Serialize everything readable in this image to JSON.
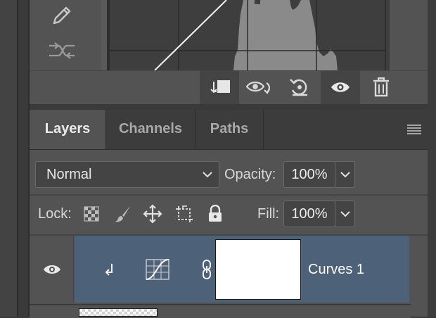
{
  "properties": {
    "tools": [
      {
        "icon": "pencil-icon"
      },
      {
        "icon": "smooth-curve-icon"
      }
    ],
    "footer_buttons": [
      {
        "icon": "clip-to-layer-icon"
      },
      {
        "icon": "view-previous-state-icon"
      },
      {
        "icon": "reset-icon"
      },
      {
        "icon": "visibility-icon"
      },
      {
        "icon": "trash-icon"
      }
    ]
  },
  "layers_panel": {
    "tabs": [
      {
        "label": "Layers",
        "active": true
      },
      {
        "label": "Channels",
        "active": false
      },
      {
        "label": "Paths",
        "active": false
      }
    ],
    "blend_mode": "Normal",
    "opacity_label": "Opacity:",
    "opacity_value": "100%",
    "lock_label": "Lock:",
    "lock_icons": [
      "lock-transparent-pixels-icon",
      "lock-image-pixels-icon",
      "lock-position-icon",
      "lock-artboard-icon",
      "lock-all-icon"
    ],
    "fill_label": "Fill:",
    "fill_value": "100%",
    "layers": [
      {
        "name": "Curves 1",
        "selected": true,
        "visible": true,
        "type": "curves-adjustment"
      }
    ]
  },
  "colors": {
    "panel_bg": "#535353",
    "selection": "#4d6178",
    "tab_bar": "#3c3c3c"
  }
}
